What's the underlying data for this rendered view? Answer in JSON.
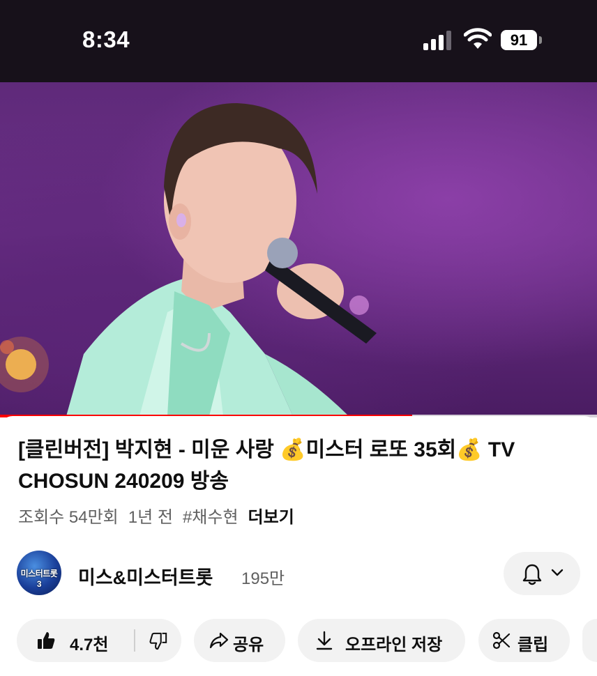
{
  "status_bar": {
    "time": "8:34",
    "battery": "91",
    "icons": [
      "signal-icon",
      "wifi-icon",
      "battery-icon"
    ]
  },
  "video": {
    "progress_fraction": 0.69
  },
  "title": "[클린버전] 박지현 - 미운 사랑 💰미스터 로또 35회💰 TV CHOSUN 240209 방송",
  "meta": {
    "views": "조회수 54만회",
    "age": "1년 전",
    "hashtag": "#채수현",
    "more": "더보기"
  },
  "channel": {
    "avatar_text": "미스터트롯3",
    "name": "미스&미스터트롯",
    "subscribers": "195만"
  },
  "actions": {
    "like_count": "4.7천",
    "share": "공유",
    "download": "오프라인 저장",
    "clip": "클립"
  },
  "colors": {
    "status_bar_bg": "#17111a",
    "progress": "#ff0000",
    "pill_bg": "#f2f2f2",
    "secondary_text": "#606060"
  }
}
